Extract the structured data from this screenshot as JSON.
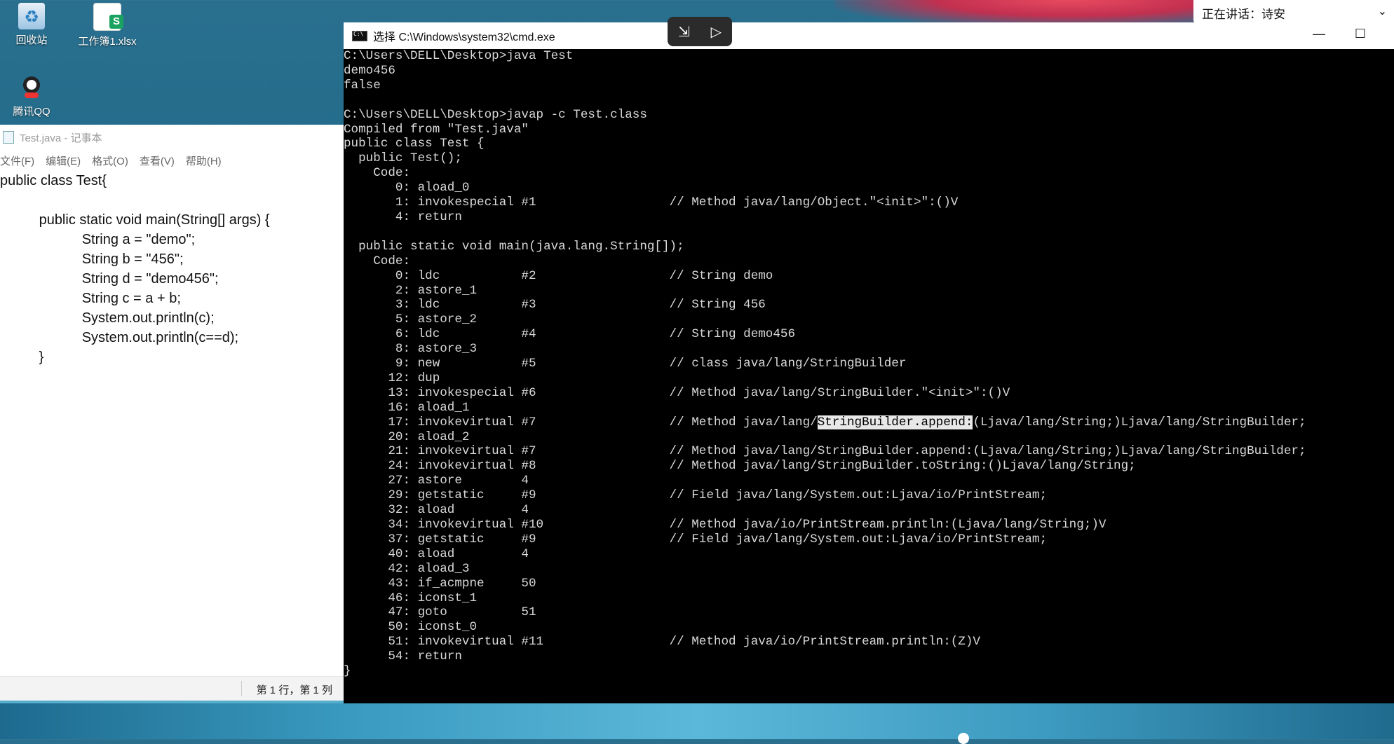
{
  "desktop": {
    "icons": [
      {
        "label": "回收站",
        "icon": "recycle-bin-icon"
      },
      {
        "label": "工作簿1.xlsx",
        "icon": "spreadsheet-icon"
      },
      {
        "label": "腾讯QQ",
        "icon": "qq-penguin-icon"
      }
    ]
  },
  "speaking_bar": {
    "text": "正在讲话：诗安"
  },
  "notepad": {
    "title": "Test.java - 记事本",
    "menu": [
      "文件(F)",
      "编辑(E)",
      "格式(O)",
      "查看(V)",
      "帮助(H)"
    ],
    "content": "public class Test{\n\n          public static void main(String[] args) {\n                     String a = \"demo\";\n                     String b = \"456\";\n                     String d = \"demo456\";\n                     String c = a + b;\n                     System.out.println(c);\n                     System.out.println(c==d);\n          }",
    "status": "第 1 行，第 1 列"
  },
  "cmd": {
    "title": "选择 C:\\Windows\\system32\\cmd.exe",
    "output_before": "C:\\Users\\DELL\\Desktop>java Test\ndemo456\nfalse\n\nC:\\Users\\DELL\\Desktop>javap -c Test.class\nCompiled from \"Test.java\"\npublic class Test {\n  public Test();\n    Code:\n       0: aload_0\n       1: invokespecial #1                  // Method java/lang/Object.\"<init>\":()V\n       4: return\n\n  public static void main(java.lang.String[]);\n    Code:\n       0: ldc           #2                  // String demo\n       2: astore_1\n       3: ldc           #3                  // String 456\n       5: astore_2\n       6: ldc           #4                  // String demo456\n       8: astore_3\n       9: new           #5                  // class java/lang/StringBuilder\n      12: dup\n      13: invokespecial #6                  // Method java/lang/StringBuilder.\"<init>\":()V\n      16: aload_1\n      17: invokevirtual #7                  // Method java/lang/",
    "highlight": "StringBuilder.append:",
    "output_after": "(Ljava/lang/String;)Ljava/lang/StringBuilder;\n      20: aload_2\n      21: invokevirtual #7                  // Method java/lang/StringBuilder.append:(Ljava/lang/String;)Ljava/lang/StringBuilder;\n      24: invokevirtual #8                  // Method java/lang/StringBuilder.toString:()Ljava/lang/String;\n      27: astore        4\n      29: getstatic     #9                  // Field java/lang/System.out:Ljava/io/PrintStream;\n      32: aload         4\n      34: invokevirtual #10                 // Method java/io/PrintStream.println:(Ljava/lang/String;)V\n      37: getstatic     #9                  // Field java/lang/System.out:Ljava/io/PrintStream;\n      40: aload         4\n      42: aload_3\n      43: if_acmpne     50\n      46: iconst_1\n      47: goto          51\n      50: iconst_0\n      51: invokevirtual #11                 // Method java/io/PrintStream.println:(Z)V\n      54: return\n}"
  }
}
